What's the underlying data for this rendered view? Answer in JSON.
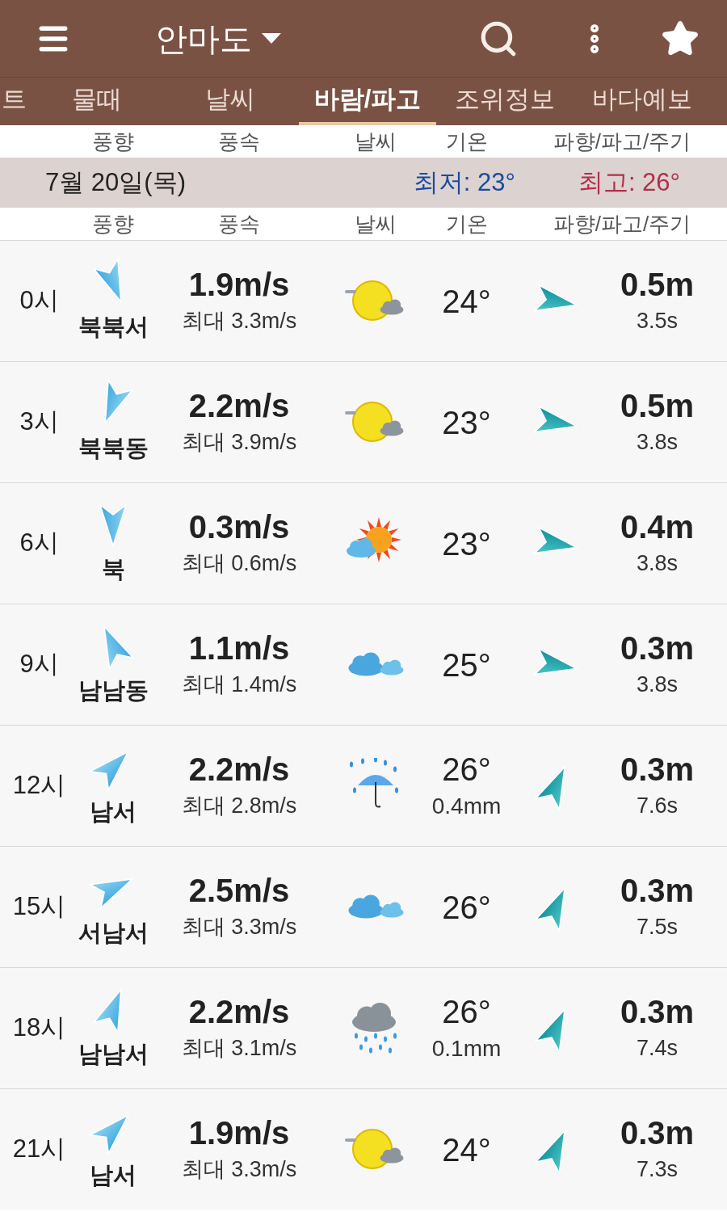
{
  "header": {
    "location": "안마도"
  },
  "tabs": [
    {
      "label": "트",
      "selected": false
    },
    {
      "label": "물때",
      "selected": false
    },
    {
      "label": "날씨",
      "selected": false
    },
    {
      "label": "바람/파고",
      "selected": true
    },
    {
      "label": "조위정보",
      "selected": false
    },
    {
      "label": "바다예보",
      "selected": false
    }
  ],
  "column_headers_top": [
    "풍향",
    "풍속",
    "날씨",
    "기온",
    "파향/파고/주기"
  ],
  "day": {
    "date": "7월 20일(목)",
    "low": "최저: 23°",
    "high": "최고: 26°"
  },
  "column_headers": [
    "풍향",
    "풍속",
    "날씨",
    "기온",
    "파향/파고/주기"
  ],
  "rows": [
    {
      "time": "0시",
      "wind_arrow": {
        "kind": "nnw"
      },
      "direction": "북북서",
      "speed": "1.9m/s",
      "max": "최대 3.3m/s",
      "weather_icon": {
        "kind": "sun-cloud"
      },
      "temp": "24°",
      "wave_arrow": {
        "kind": "e"
      },
      "wave": "0.5m",
      "period": "3.5s"
    },
    {
      "time": "3시",
      "wind_arrow": {
        "kind": "nne"
      },
      "direction": "북북동",
      "speed": "2.2m/s",
      "max": "최대 3.9m/s",
      "weather_icon": {
        "kind": "sun-cloud"
      },
      "temp": "23°",
      "wave_arrow": {
        "kind": "e"
      },
      "wave": "0.5m",
      "period": "3.8s"
    },
    {
      "time": "6시",
      "wind_arrow": {
        "kind": "n"
      },
      "direction": "북",
      "speed": "0.3m/s",
      "max": "최대 0.6m/s",
      "weather_icon": {
        "kind": "sun-rays"
      },
      "temp": "23°",
      "wave_arrow": {
        "kind": "e"
      },
      "wave": "0.4m",
      "period": "3.8s"
    },
    {
      "time": "9시",
      "wind_arrow": {
        "kind": "sse"
      },
      "direction": "남남동",
      "speed": "1.1m/s",
      "max": "최대 1.4m/s",
      "weather_icon": {
        "kind": "cloudy"
      },
      "temp": "25°",
      "wave_arrow": {
        "kind": "e"
      },
      "wave": "0.3m",
      "period": "3.8s"
    },
    {
      "time": "12시",
      "wind_arrow": {
        "kind": "sw"
      },
      "direction": "남서",
      "speed": "2.2m/s",
      "max": "최대 2.8m/s",
      "weather_icon": {
        "kind": "umbrella"
      },
      "temp": "26°",
      "rain": "0.4mm",
      "wave_arrow": {
        "kind": "nne"
      },
      "wave": "0.3m",
      "period": "7.6s"
    },
    {
      "time": "15시",
      "wind_arrow": {
        "kind": "wsw"
      },
      "direction": "서남서",
      "speed": "2.5m/s",
      "max": "최대 3.3m/s",
      "weather_icon": {
        "kind": "cloudy"
      },
      "temp": "26°",
      "wave_arrow": {
        "kind": "nne"
      },
      "wave": "0.3m",
      "period": "7.5s"
    },
    {
      "time": "18시",
      "wind_arrow": {
        "kind": "ssw"
      },
      "direction": "남남서",
      "speed": "2.2m/s",
      "max": "최대 3.1m/s",
      "weather_icon": {
        "kind": "rain"
      },
      "temp": "26°",
      "rain": "0.1mm",
      "wave_arrow": {
        "kind": "nne"
      },
      "wave": "0.3m",
      "period": "7.4s"
    },
    {
      "time": "21시",
      "wind_arrow": {
        "kind": "sw"
      },
      "direction": "남서",
      "speed": "1.9m/s",
      "max": "최대 3.3m/s",
      "weather_icon": {
        "kind": "sun-cloud"
      },
      "temp": "24°",
      "wave_arrow": {
        "kind": "nne"
      },
      "wave": "0.3m",
      "period": "7.3s"
    }
  ]
}
